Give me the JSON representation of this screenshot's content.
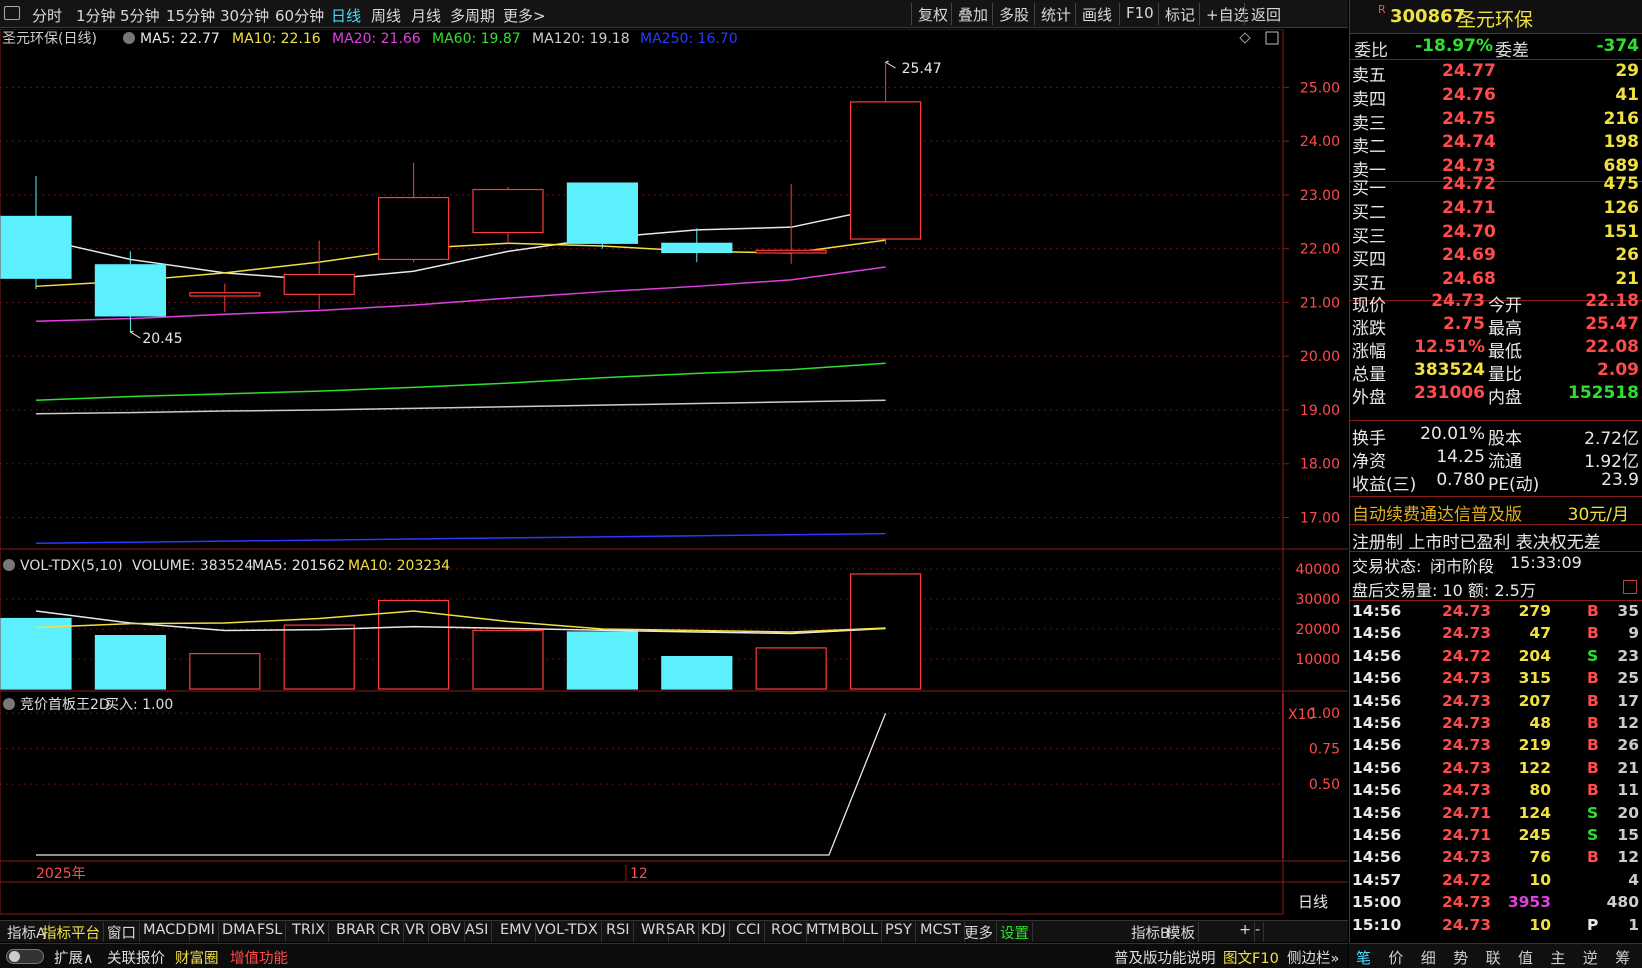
{
  "toolbar": {
    "periods": [
      "分时",
      "1分钟",
      "5分钟",
      "15分钟",
      "30分钟",
      "60分钟",
      "日线",
      "周线",
      "月线",
      "多周期",
      "更多>"
    ],
    "active": "日线",
    "actions": [
      "复权",
      "叠加",
      "多股",
      "统计",
      "画线",
      "F10",
      "标记",
      "+自选",
      "返回"
    ]
  },
  "main_chart": {
    "legend": [
      {
        "text": "圣元环保(日线)",
        "color": "#cccccc"
      },
      {
        "text": "MA5: 22.77",
        "color": "#e8e8e8"
      },
      {
        "text": "MA10: 22.16",
        "color": "#f0e040"
      },
      {
        "text": "MA20: 21.66",
        "color": "#e040e0"
      },
      {
        "text": "MA60: 19.87",
        "color": "#2ee02e"
      },
      {
        "text": "MA120: 19.18",
        "color": "#cccccc"
      },
      {
        "text": "MA250: 16.70",
        "color": "#2a3aff"
      }
    ]
  },
  "volume_panel": {
    "legend": [
      {
        "text": "VOL-TDX(5,10)",
        "color": "#dddddd"
      },
      {
        "text": "VOLUME: 383524",
        "color": "#dddddd"
      },
      {
        "text": "MA5: 201562",
        "color": "#e8e8e8"
      },
      {
        "text": "MA10: 203234",
        "color": "#f0e040"
      }
    ],
    "scale_tag": "X10"
  },
  "indicator_panel": {
    "legend": [
      {
        "text": "竞价首板王2D",
        "color": "#dddddd"
      },
      {
        "text": "买入: 1.00",
        "color": "#dddddd"
      }
    ]
  },
  "chart_data": [
    {
      "type": "candlestick",
      "title": "圣元环保(日线)",
      "ylim": [
        16.6,
        25.9
      ],
      "yticks": [
        "25.00",
        "24.00",
        "23.00",
        "22.00",
        "21.00",
        "20.00",
        "19.00",
        "18.00",
        "17.00"
      ],
      "xlabels": [
        "2025年",
        "12"
      ],
      "annotations": {
        "high": "25.47",
        "low": "20.45"
      },
      "candles": [
        {
          "open": 22.6,
          "close": 21.45,
          "high": 23.35,
          "low": 21.25
        },
        {
          "open": 21.7,
          "close": 20.75,
          "high": 21.95,
          "low": 20.45
        },
        {
          "open": 21.12,
          "close": 21.18,
          "high": 21.35,
          "low": 20.82
        },
        {
          "open": 21.15,
          "close": 21.52,
          "high": 22.15,
          "low": 20.88
        },
        {
          "open": 21.8,
          "close": 22.95,
          "high": 23.6,
          "low": 21.75
        },
        {
          "open": 22.3,
          "close": 23.1,
          "high": 23.15,
          "low": 22.1
        },
        {
          "open": 23.22,
          "close": 22.1,
          "high": 23.22,
          "low": 22.0
        },
        {
          "open": 22.1,
          "close": 21.93,
          "high": 22.38,
          "low": 21.75
        },
        {
          "open": 21.92,
          "close": 21.97,
          "high": 23.2,
          "low": 21.72
        },
        {
          "open": 22.18,
          "close": 24.73,
          "high": 25.47,
          "low": 22.08
        }
      ],
      "series": [
        {
          "name": "MA5",
          "color": "#e8e8e8",
          "values": [
            22.2,
            21.8,
            21.55,
            21.42,
            21.58,
            21.95,
            22.2,
            22.35,
            22.4,
            22.77
          ]
        },
        {
          "name": "MA10",
          "color": "#f0e040",
          "values": [
            21.3,
            21.4,
            21.55,
            21.75,
            22.0,
            22.1,
            22.05,
            21.95,
            21.92,
            22.16
          ]
        },
        {
          "name": "MA20",
          "color": "#e040e0",
          "values": [
            20.65,
            20.7,
            20.78,
            20.85,
            20.95,
            21.08,
            21.2,
            21.3,
            21.42,
            21.66
          ]
        },
        {
          "name": "MA60",
          "color": "#2ee02e",
          "values": [
            19.18,
            19.25,
            19.3,
            19.35,
            19.42,
            19.5,
            19.6,
            19.68,
            19.75,
            19.87
          ]
        },
        {
          "name": "MA120",
          "color": "#cccccc",
          "values": [
            18.93,
            18.95,
            18.98,
            19.0,
            19.03,
            19.06,
            19.09,
            19.12,
            19.15,
            19.18
          ]
        },
        {
          "name": "MA250",
          "color": "#2a3aff",
          "values": [
            16.52,
            16.54,
            16.56,
            16.58,
            16.6,
            16.62,
            16.64,
            16.66,
            16.68,
            16.7
          ]
        }
      ]
    },
    {
      "type": "bar",
      "title": "VOL-TDX(5,10)",
      "ylim": [
        0,
        42000
      ],
      "yticks": [
        "40000",
        "30000",
        "20000",
        "10000"
      ],
      "values": [
        23500,
        17800,
        11800,
        21300,
        29500,
        19500,
        19000,
        10800,
        13700,
        38352
      ],
      "up": [
        false,
        false,
        true,
        true,
        true,
        true,
        false,
        false,
        true,
        true
      ],
      "series": [
        {
          "name": "MA5",
          "color": "#e8e8e8",
          "values": [
            26000,
            22000,
            19500,
            19800,
            20800,
            20200,
            19600,
            19000,
            18500,
            20156
          ]
        },
        {
          "name": "MA10",
          "color": "#f0e040",
          "values": [
            20500,
            21800,
            22000,
            23500,
            26000,
            22500,
            20000,
            19500,
            19000,
            20323
          ]
        }
      ]
    },
    {
      "type": "line",
      "title": "竞价首板王2D",
      "ylim": [
        0,
        1.1
      ],
      "yticks": [
        "1.00",
        "0.75",
        "0.50"
      ],
      "x": [
        1,
        2,
        3,
        4,
        5,
        6,
        7,
        8,
        9,
        10
      ],
      "values": [
        0,
        0,
        0,
        0,
        0,
        0,
        0,
        0,
        0,
        1.0
      ],
      "series_name": "买入"
    }
  ],
  "quote": {
    "code": "300867",
    "name": "圣元环保",
    "mark": "R",
    "webi": {
      "label": "委比",
      "value": "-18.97%",
      "label2": "委差",
      "value2": "-374"
    },
    "asks": [
      {
        "label": "卖五",
        "price": "24.77",
        "vol": "29"
      },
      {
        "label": "卖四",
        "price": "24.76",
        "vol": "41"
      },
      {
        "label": "卖三",
        "price": "24.75",
        "vol": "216"
      },
      {
        "label": "卖二",
        "price": "24.74",
        "vol": "198"
      },
      {
        "label": "卖一",
        "price": "24.73",
        "vol": "689"
      }
    ],
    "bids": [
      {
        "label": "买一",
        "price": "24.72",
        "vol": "475"
      },
      {
        "label": "买二",
        "price": "24.71",
        "vol": "126"
      },
      {
        "label": "买三",
        "price": "24.70",
        "vol": "151"
      },
      {
        "label": "买四",
        "price": "24.69",
        "vol": "26"
      },
      {
        "label": "买五",
        "price": "24.68",
        "vol": "21"
      }
    ],
    "stats": [
      {
        "l1": "现价",
        "v1": "24.73",
        "c1": "red",
        "l2": "今开",
        "v2": "22.18",
        "c2": "red"
      },
      {
        "l1": "涨跌",
        "v1": "2.75",
        "c1": "red",
        "l2": "最高",
        "v2": "25.47",
        "c2": "red"
      },
      {
        "l1": "涨幅",
        "v1": "12.51%",
        "c1": "red",
        "l2": "最低",
        "v2": "22.08",
        "c2": "red"
      },
      {
        "l1": "总量",
        "v1": "383524",
        "c1": "yel",
        "l2": "量比",
        "v2": "2.09",
        "c2": "red"
      },
      {
        "l1": "外盘",
        "v1": "231006",
        "c1": "red",
        "l2": "内盘",
        "v2": "152518",
        "c2": "grn"
      }
    ],
    "stats2": [
      {
        "l1": "换手",
        "v1": "20.01%",
        "l2": "股本",
        "v2": "2.72亿"
      },
      {
        "l1": "净资",
        "v1": "14.25",
        "l2": "流通",
        "v2": "1.92亿"
      },
      {
        "l1": "收益(三)",
        "v1": "0.780",
        "l2": "PE(动)",
        "v2": "23.9"
      }
    ],
    "promo": {
      "text": "自动续费通达信普及版",
      "price": "30元/月"
    },
    "reg": "注册制 上市时已盈利 表决权无差",
    "status": {
      "label": "交易状态:",
      "value": "闭市阶段",
      "time": "15:33:09"
    },
    "after": {
      "text": "盘后交易量: 10  额: 2.5万"
    },
    "ticks": [
      {
        "t": "14:56",
        "p": "24.73",
        "v": "279",
        "s": "B",
        "n": "35"
      },
      {
        "t": "14:56",
        "p": "24.73",
        "v": "47",
        "s": "B",
        "n": "9"
      },
      {
        "t": "14:56",
        "p": "24.72",
        "v": "204",
        "s": "S",
        "n": "23"
      },
      {
        "t": "14:56",
        "p": "24.73",
        "v": "315",
        "s": "B",
        "n": "25"
      },
      {
        "t": "14:56",
        "p": "24.73",
        "v": "207",
        "s": "B",
        "n": "17"
      },
      {
        "t": "14:56",
        "p": "24.73",
        "v": "48",
        "s": "B",
        "n": "12"
      },
      {
        "t": "14:56",
        "p": "24.73",
        "v": "219",
        "s": "B",
        "n": "26"
      },
      {
        "t": "14:56",
        "p": "24.73",
        "v": "122",
        "s": "B",
        "n": "21"
      },
      {
        "t": "14:56",
        "p": "24.73",
        "v": "80",
        "s": "B",
        "n": "11"
      },
      {
        "t": "14:56",
        "p": "24.71",
        "v": "124",
        "s": "S",
        "n": "20"
      },
      {
        "t": "14:56",
        "p": "24.71",
        "v": "245",
        "s": "S",
        "n": "15"
      },
      {
        "t": "14:56",
        "p": "24.73",
        "v": "76",
        "s": "B",
        "n": "12"
      },
      {
        "t": "14:57",
        "p": "24.72",
        "v": "10",
        "s": "",
        "n": "4"
      },
      {
        "t": "15:00",
        "p": "24.73",
        "v": "3953",
        "s": "",
        "n": "480"
      },
      {
        "t": "15:10",
        "p": "24.73",
        "v": "10",
        "s": "P",
        "n": "1"
      }
    ]
  },
  "period_label": "日线",
  "indicator_tabs": [
    "指标A",
    "指标平台",
    "窗口",
    "MACD",
    "DMI",
    "DMA",
    "FSL",
    "TRIX",
    "BRAR",
    "CR",
    "VR",
    "OBV",
    "ASI",
    "EMV",
    "VOL-TDX",
    "RSI",
    "WR",
    "SAR",
    "KDJ",
    "CCI",
    "ROC",
    "MTM",
    "BOLL",
    "PSY",
    "MCST",
    "更多",
    "设置",
    "指标B",
    "模板",
    "+",
    "-"
  ],
  "status_items": [
    {
      "text": "扩展∧",
      "color": "#dddddd"
    },
    {
      "text": "关联报价",
      "color": "#dddddd"
    },
    {
      "text": "财富圈",
      "color": "#f0e040"
    },
    {
      "text": "增值功能",
      "color": "#ff4b4b"
    }
  ],
  "status_right": [
    {
      "text": "普及版功能说明",
      "color": "#dddddd"
    },
    {
      "text": "图文F10",
      "color": "#f0e040"
    },
    {
      "text": "侧边栏»",
      "color": "#dddddd"
    }
  ],
  "quote_tabs": [
    "笔",
    "价",
    "细",
    "势",
    "联",
    "值",
    "主",
    "逆",
    "筹"
  ]
}
